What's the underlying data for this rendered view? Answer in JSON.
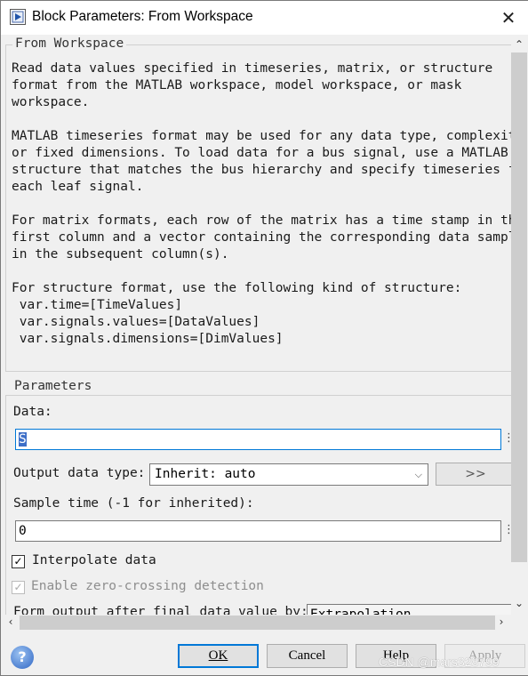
{
  "window": {
    "title": "Block Parameters: From Workspace",
    "close_glyph": "✕"
  },
  "block_group": {
    "legend": "From Workspace",
    "description": [
      "Read data values specified in timeseries, matrix, or structure",
      "format from the MATLAB workspace, model workspace, or mask",
      "workspace.",
      "",
      "MATLAB timeseries format may be used for any data type, complexity",
      "or fixed dimensions. To load data for a bus signal, use a MATLAB",
      "structure that matches the bus hierarchy and specify timeseries fo",
      "each leaf signal.",
      "",
      "For matrix formats, each row of the matrix has a time stamp in the",
      "first column and a vector containing the corresponding data sample",
      "in the subsequent column(s).",
      "",
      "For structure format, use the following kind of structure:",
      " var.time=[TimeValues]",
      " var.signals.values=[DataValues]",
      " var.signals.dimensions=[DimValues]"
    ]
  },
  "parameters": {
    "legend": "Parameters",
    "data_label": "Data:",
    "data_value": "S",
    "output_type_label": "Output data type:",
    "output_type_value": "Inherit: auto",
    "more_button": ">>",
    "sample_time_label": "Sample time (-1 for inherited):",
    "sample_time_value": "0",
    "interpolate_label": "Interpolate data",
    "interpolate_checked": true,
    "zero_crossing_label": "Enable zero-crossing detection",
    "zero_crossing_checked": true,
    "zero_crossing_enabled": false,
    "form_output_label": "Form output after final data value by:",
    "form_output_value": "Extrapolation"
  },
  "buttons": {
    "ok": "OK",
    "cancel": "Cancel",
    "help": "Help",
    "apply": "Apply"
  },
  "watermark": "CSDN @mars328799"
}
